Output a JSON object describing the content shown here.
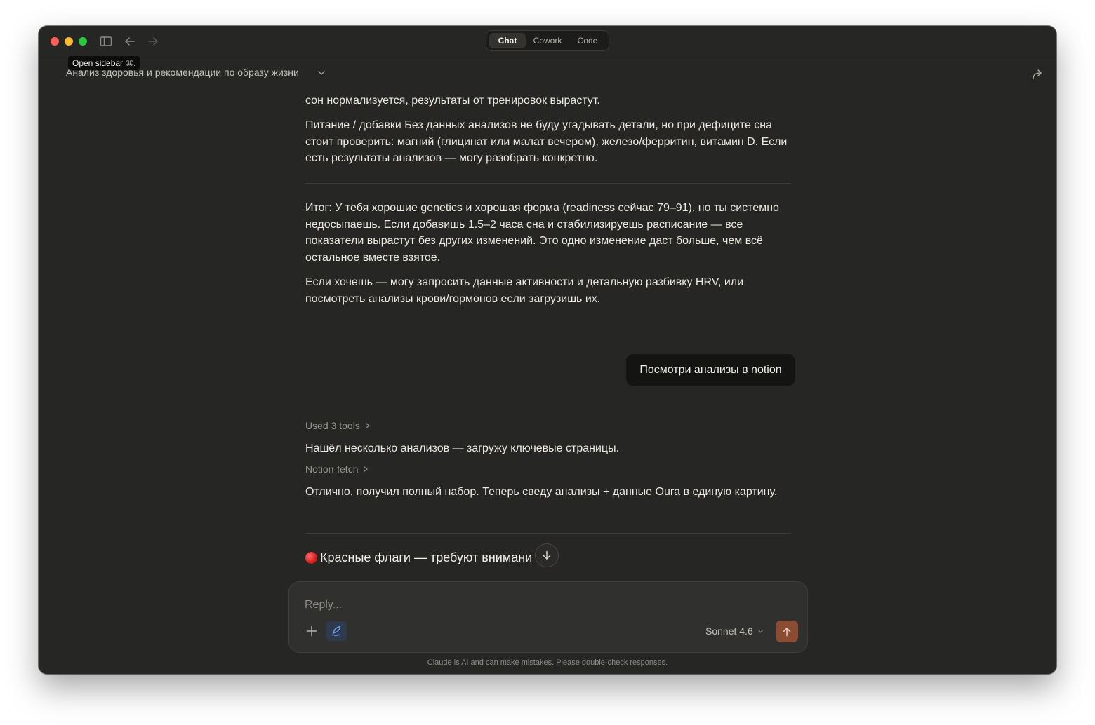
{
  "window": {
    "tooltip": {
      "label": "Open sidebar",
      "shortcut": "⌘."
    },
    "mode_tabs": [
      "Chat",
      "Cowork",
      "Code"
    ],
    "active_mode": "Chat"
  },
  "conversation": {
    "title": "Анализ здоровья и рекомендации по образу жизни"
  },
  "messages": {
    "p1": "сон нормализуется, результаты от тренировок вырастут.",
    "p2": "Питание / добавки Без данных анализов не буду угадывать детали, но при дефиците сна стоит проверить: магний (глицинат или малат вечером), железо/ферритин, витамин D. Если есть результаты анализов — могу разобрать конкретно.",
    "p3": "Итог: У тебя хорошие genetics и хорошая форма (readiness сейчас 79–91), но ты системно недосыпаешь. Если добавишь 1.5–2 часа сна и стабилизируешь расписание — все показатели вырастут без других изменений. Это одно изменение даст больше, чем всё остальное вместе взятое.",
    "p4": "Если хочешь — могу запросить данные активности и детальную разбивку HRV, или посмотреть анализы крови/гормонов если загрузишь их.",
    "user_message": "Посмотри анализы в notion",
    "tools_used": "Used 3 tools",
    "p5": "Нашёл несколько анализов — загружу ключевые страницы.",
    "tool_fetch": "Notion-fetch",
    "p6": "Отлично, получил полный набор. Теперь сведу анализы + данные Oura в единую картину.",
    "heading_red_flags": "Красные флаги — требуют внимани"
  },
  "composer": {
    "placeholder": "Reply...",
    "model": "Sonnet 4.6"
  },
  "footer": {
    "disclaimer": "Claude is AI and can make mistakes. Please double-check responses."
  },
  "colors": {
    "background": "#262624",
    "send_button": "#8a4d34",
    "style_button_accent": "#6f9ef0"
  }
}
